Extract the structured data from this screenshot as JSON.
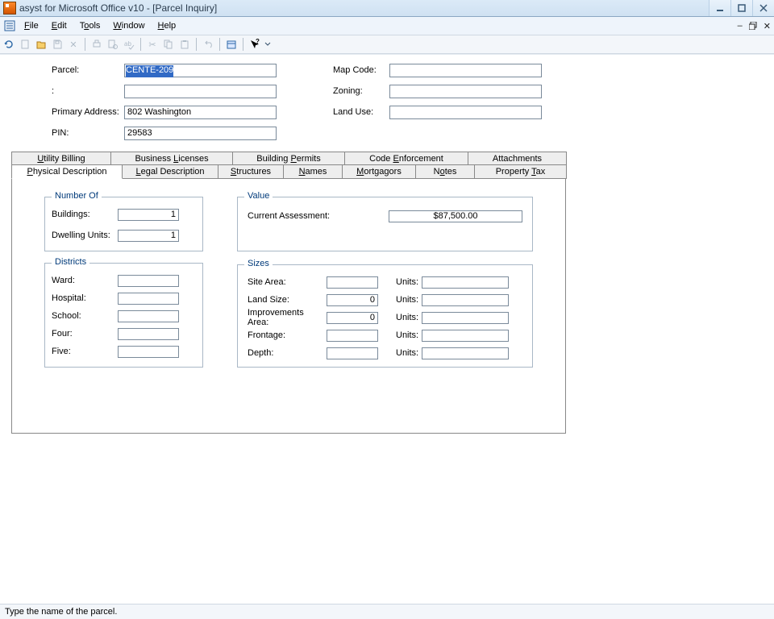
{
  "window": {
    "title": "asyst for Microsoft Office v10 - [Parcel Inquiry]"
  },
  "menu": {
    "file": "File",
    "edit": "Edit",
    "tools": "Tools",
    "window": "Window",
    "help": "Help"
  },
  "header": {
    "parcel_label": "Parcel:",
    "parcel_value": "CENTE-209",
    "blank_label": ":",
    "blank_value": "",
    "primary_address_label": "Primary Address:",
    "primary_address_value": "802 Washington",
    "pin_label": "PIN:",
    "pin_value": "29583",
    "map_code_label": "Map Code:",
    "map_code_value": "",
    "zoning_label": "Zoning:",
    "zoning_value": "",
    "land_use_label": "Land Use:",
    "land_use_value": ""
  },
  "tabs": {
    "top": {
      "utility_billing": "Utility Billing",
      "business_licenses": "Business Licenses",
      "building_permits": "Building Permits",
      "code_enforcement": "Code Enforcement",
      "attachments": "Attachments"
    },
    "bottom": {
      "physical_description": "Physical Description",
      "legal_description": "Legal Description",
      "structures": "Structures",
      "names": "Names",
      "mortgagors": "Mortgagors",
      "notes": "Notes",
      "property_tax": "Property Tax"
    }
  },
  "groups": {
    "number_of": {
      "legend": "Number Of",
      "buildings_label": "Buildings:",
      "buildings_value": "1",
      "dwelling_label": "Dwelling Units:",
      "dwelling_value": "1"
    },
    "value": {
      "legend": "Value",
      "assessment_label": "Current Assessment:",
      "assessment_value": "$87,500.00"
    },
    "districts": {
      "legend": "Districts",
      "ward_label": "Ward:",
      "ward_value": "",
      "hospital_label": "Hospital:",
      "hospital_value": "",
      "school_label": "School:",
      "school_value": "",
      "four_label": "Four:",
      "four_value": "",
      "five_label": "Five:",
      "five_value": ""
    },
    "sizes": {
      "legend": "Sizes",
      "units_label": "Units:",
      "site_area_label": "Site Area:",
      "site_area_value": "",
      "site_area_units": "",
      "land_size_label": "Land Size:",
      "land_size_value": "0",
      "land_size_units": "",
      "improvements_label": "Improvements Area:",
      "improvements_value": "0",
      "improvements_units": "",
      "frontage_label": "Frontage:",
      "frontage_value": "",
      "frontage_units": "",
      "depth_label": "Depth:",
      "depth_value": "",
      "depth_units": ""
    }
  },
  "status": {
    "message": "Type the name of the parcel."
  }
}
